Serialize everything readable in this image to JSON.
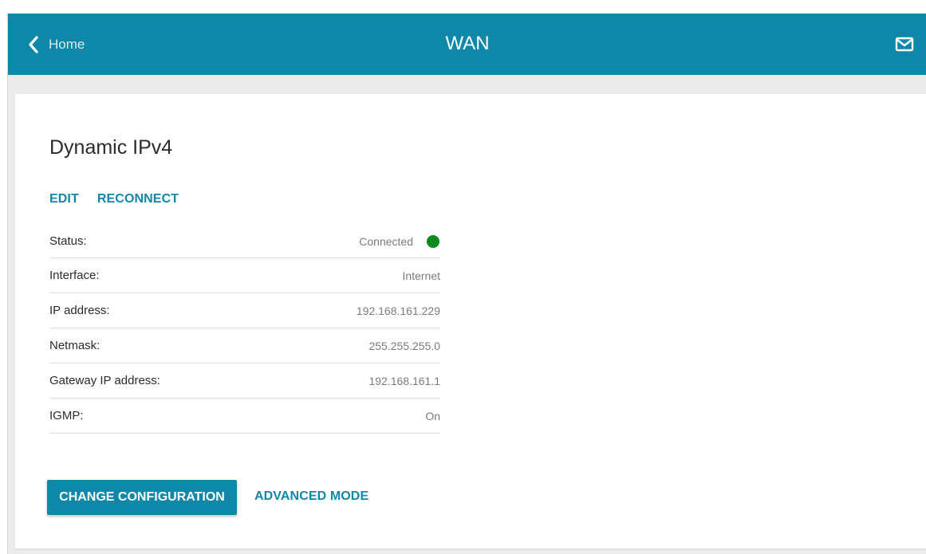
{
  "header": {
    "back_label": "Home",
    "title": "WAN",
    "mail_icon": "envelope-icon",
    "back_icon": "chevron-left-icon",
    "color": "#0e87a8"
  },
  "connection": {
    "title": "Dynamic IPv4",
    "actions": {
      "edit": "EDIT",
      "reconnect": "RECONNECT"
    },
    "rows": [
      {
        "label": "Status:",
        "value": "Connected",
        "status_color": "#0a8a1f"
      },
      {
        "label": "Interface:",
        "value": "Internet"
      },
      {
        "label": "IP address:",
        "value": "192.168.161.229"
      },
      {
        "label": "Netmask:",
        "value": "255.255.255.0"
      },
      {
        "label": "Gateway IP address:",
        "value": "192.168.161.1"
      },
      {
        "label": "IGMP:",
        "value": "On"
      }
    ]
  },
  "buttons": {
    "change_configuration": "CHANGE CONFIGURATION",
    "advanced_mode": "ADVANCED MODE"
  }
}
